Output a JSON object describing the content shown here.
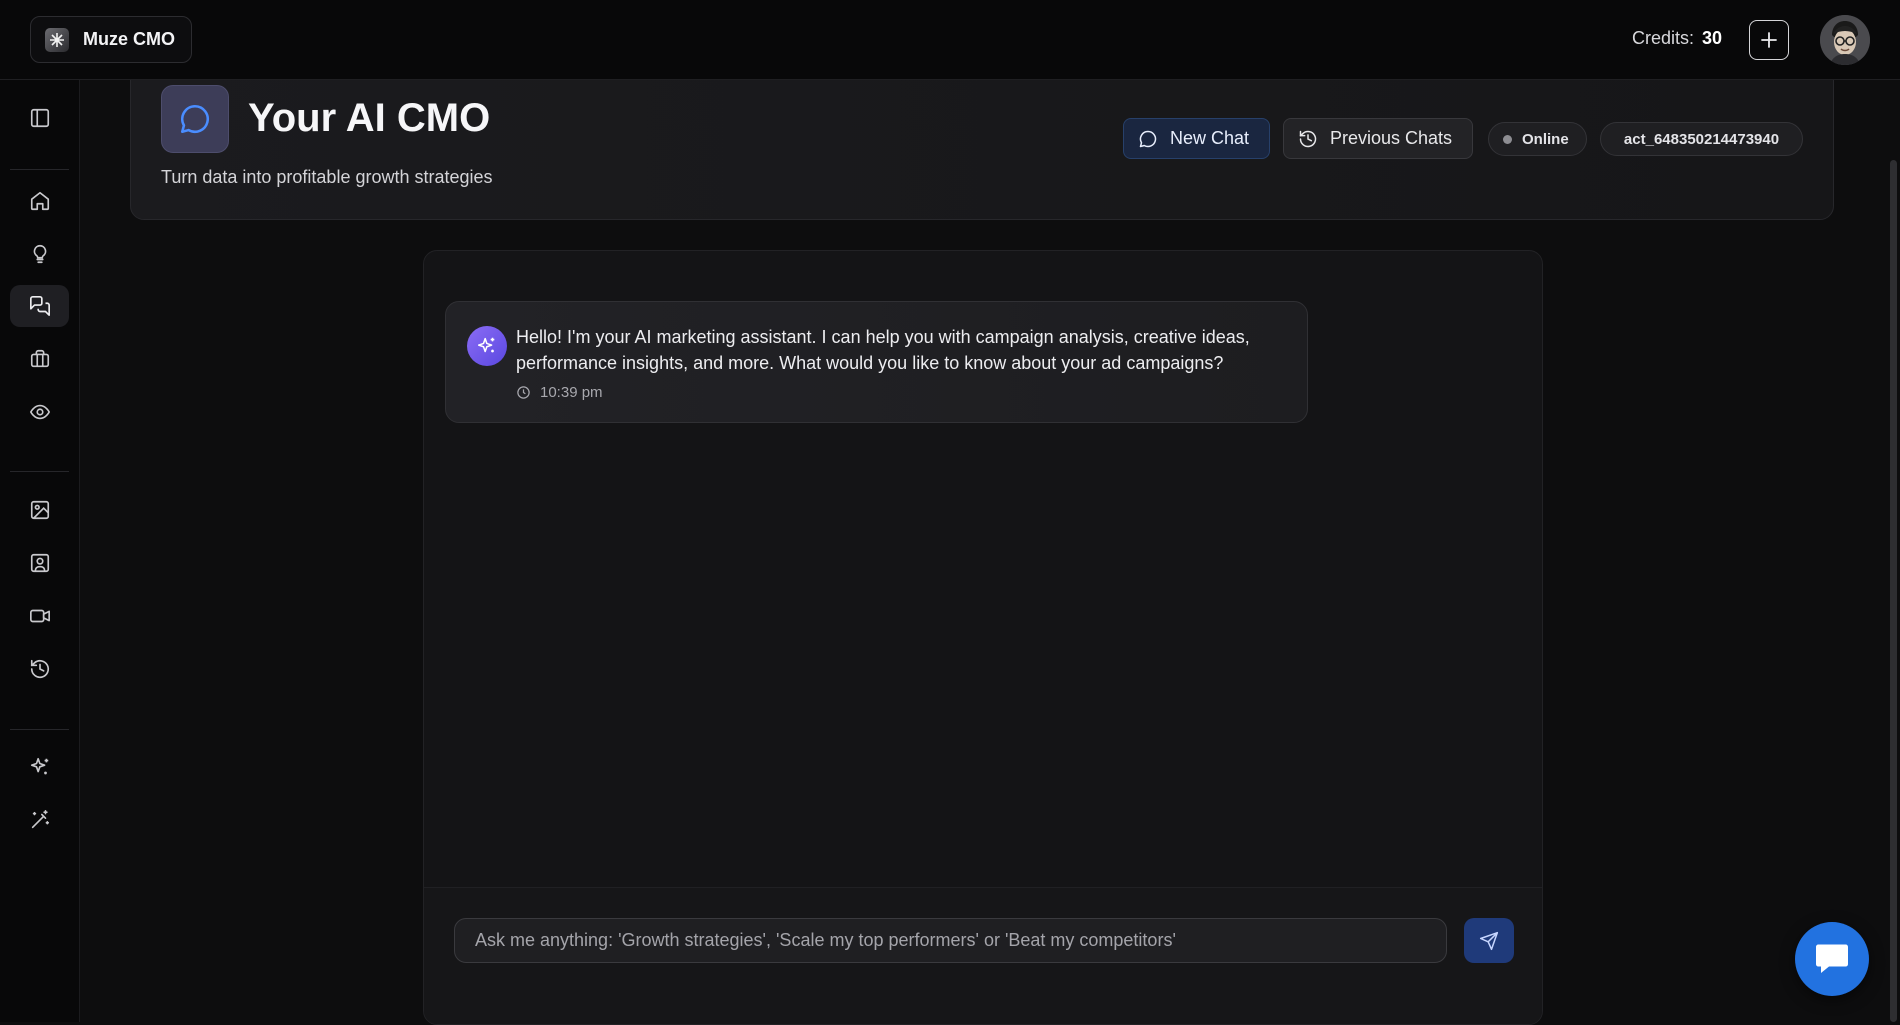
{
  "topbar": {
    "app_name": "Muze CMO",
    "credits_label": "Credits:",
    "credits_value": "30"
  },
  "sidebar": {
    "items": [
      {
        "name": "sidebar-toggle",
        "icon": "panel-left-icon"
      },
      {
        "name": "sidebar-item-home",
        "icon": "home-icon"
      },
      {
        "name": "sidebar-item-ideas",
        "icon": "lightbulb-icon"
      },
      {
        "name": "sidebar-item-chat",
        "icon": "chat-icon",
        "active": true
      },
      {
        "name": "sidebar-item-briefcase",
        "icon": "briefcase-icon"
      },
      {
        "name": "sidebar-item-watch",
        "icon": "eye-icon"
      },
      {
        "name": "sidebar-item-images",
        "icon": "image-icon"
      },
      {
        "name": "sidebar-item-personas",
        "icon": "user-square-icon"
      },
      {
        "name": "sidebar-item-video",
        "icon": "video-icon"
      },
      {
        "name": "sidebar-item-history",
        "icon": "history-icon"
      },
      {
        "name": "sidebar-item-ai",
        "icon": "sparkles-icon"
      },
      {
        "name": "sidebar-item-magic",
        "icon": "magic-wand-icon"
      }
    ]
  },
  "header": {
    "title": "Your AI CMO",
    "subtitle": "Turn data into profitable growth strategies",
    "new_chat_label": "New Chat",
    "previous_chats_label": "Previous Chats",
    "status_label": "Online",
    "account_id": "act_648350214473940"
  },
  "chat": {
    "messages": [
      {
        "sender": "assistant",
        "text": "Hello! I'm your AI marketing assistant. I can help you with campaign analysis, creative ideas, performance insights, and more. What would you like to know about your ad campaigns?",
        "time": "10:39 pm"
      }
    ],
    "input_placeholder": "Ask me anything: 'Growth strategies', 'Scale my top performers' or 'Beat my competitors'",
    "input_value": ""
  },
  "colors": {
    "accent": "#2272e0",
    "assistant_avatar": "#7b5cf0",
    "background": "#0d0d0e"
  }
}
